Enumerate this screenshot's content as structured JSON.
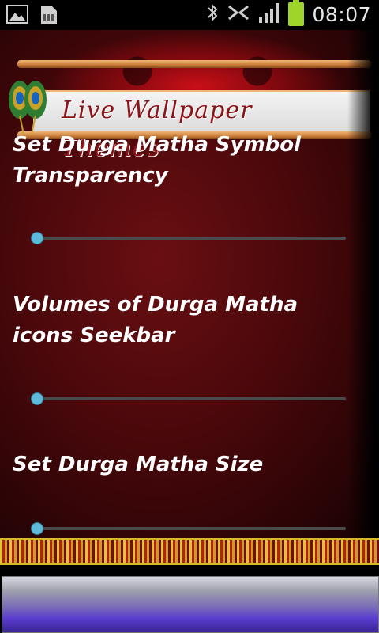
{
  "status_bar": {
    "time": "08:07",
    "left_icons": [
      "image-notification-icon",
      "sd-card-icon"
    ],
    "right_icons": [
      "bluetooth-icon",
      "nfc-icon",
      "signal-icon",
      "battery-icon"
    ],
    "battery_color": "#9ed52a"
  },
  "banner": {
    "title": "Live Wallpaper Themes"
  },
  "settings": [
    {
      "title": "Set Durga Matha Symbol Transparency",
      "value": 0
    },
    {
      "title": "Volumes of Durga Matha icons Seekbar",
      "value": 0
    },
    {
      "title": "Set Durga Matha Size",
      "value": 0
    }
  ],
  "colors": {
    "background": "#4a080b",
    "seek_thumb": "#5fb9d8",
    "seek_track": "#4a4a4a",
    "title_text": "#ffffff",
    "banner_text": "#8b1418"
  }
}
